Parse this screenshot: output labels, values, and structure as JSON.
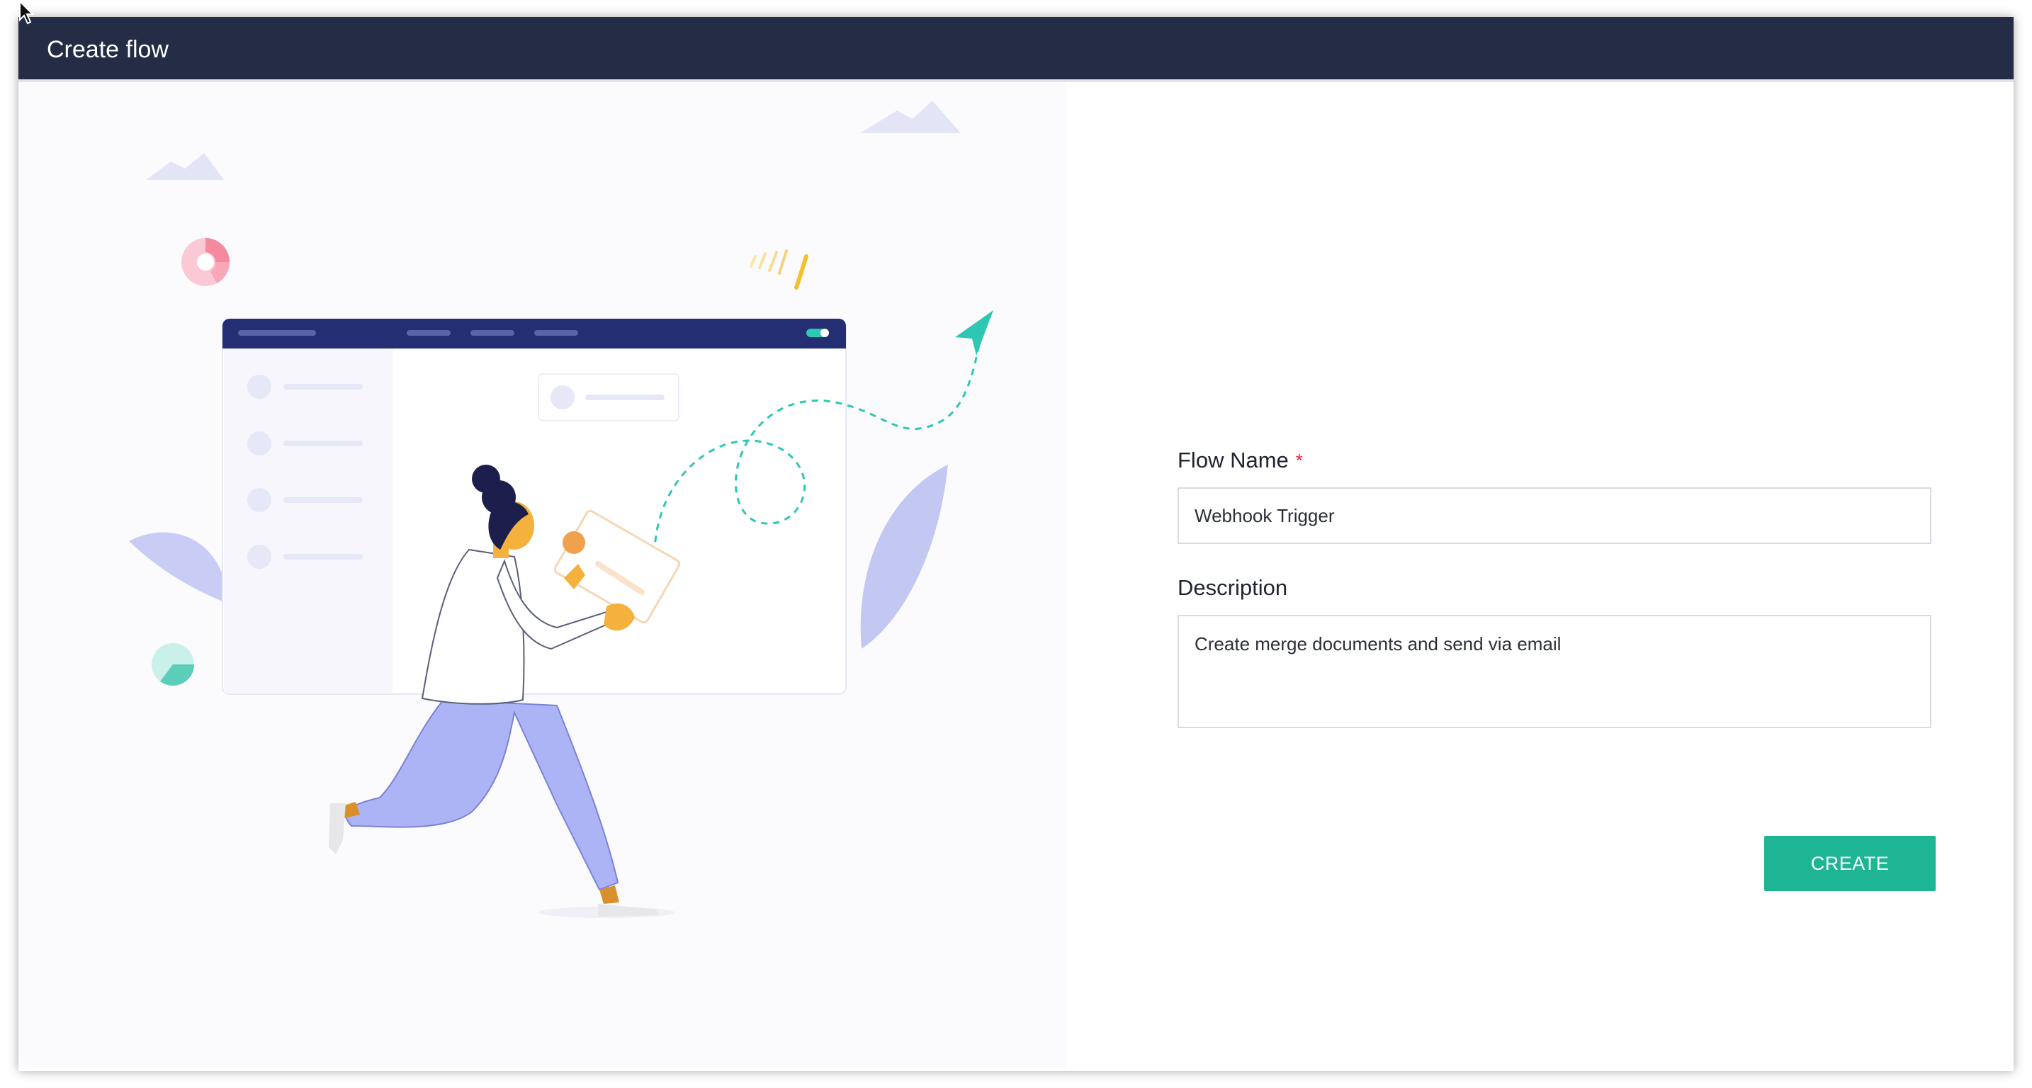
{
  "window": {
    "title": "Create flow"
  },
  "form": {
    "flow_name_label": "Flow Name",
    "required_marker": "*",
    "flow_name_value": "Webhook Trigger",
    "description_label": "Description",
    "description_value": "Create merge documents and send via email",
    "create_button": "CREATE"
  },
  "colors": {
    "titlebar": "#252c45",
    "accent": "#1db593",
    "required": "#e0263a"
  }
}
